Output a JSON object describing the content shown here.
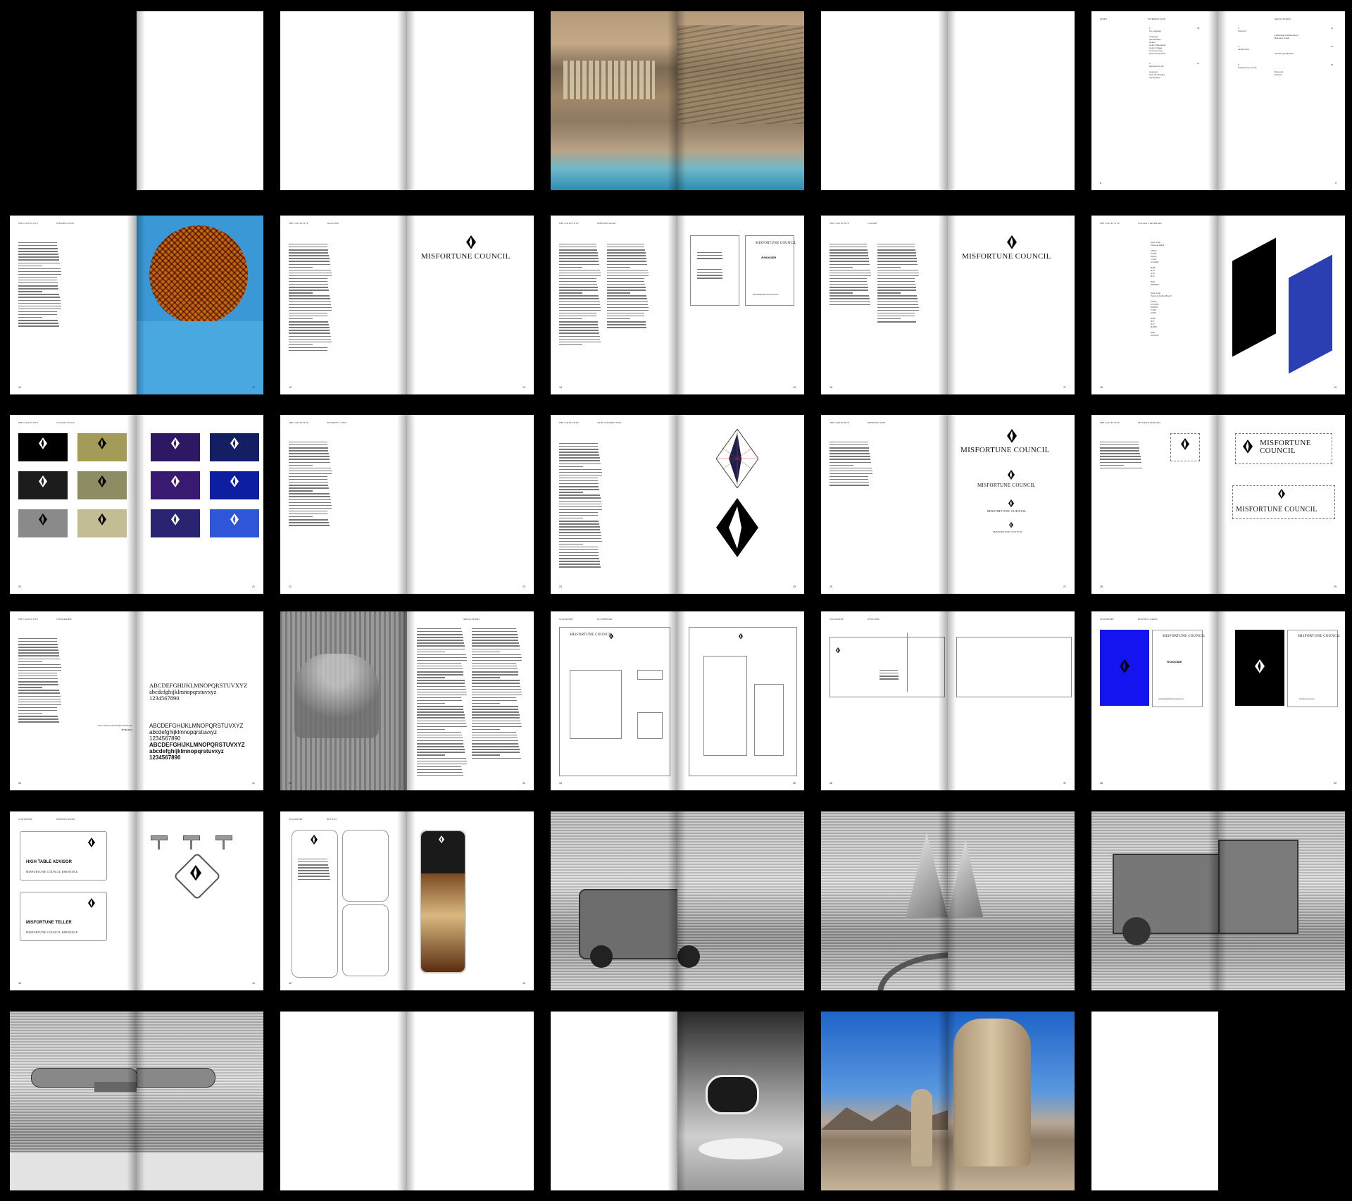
{
  "wordmark": "MISFORTUNE COUNCIL",
  "associate_label": "Associate",
  "role_cards": [
    "HIGH TABLE ADVISOR",
    "MISFORTUNE TELLER"
  ],
  "role_subtitle": "MISFORTUNE COUNCIL EMINENCE",
  "typography": {
    "upper": "ABCDEFGHIJKLMNOPQRSTUVXYZ",
    "lower": "abcdefghijklmnopqrstuvxyz",
    "digits": "1234567890",
    "serif_label": "Neue Haas Unica Display 55 Roman",
    "medium_label": "65 Medium"
  },
  "colors": {
    "background": "#000000",
    "page": "#ffffff",
    "brand_black": "#000000",
    "brand_blue": "#2b3fb2",
    "gold": "#a59b58",
    "olive": "#8e8c62",
    "khaki": "#c2bd94",
    "grey": "#8a8a8a",
    "purple": "#2e1863",
    "navy": "#141e63",
    "deep_purple": "#3a1a70",
    "royal": "#0d1ea0",
    "violet": "#2a2370",
    "bright_blue": "#2f56d6"
  },
  "page_numbers": [
    "8",
    "9",
    "10",
    "11",
    "12",
    "13",
    "14",
    "15",
    "16",
    "17",
    "18",
    "19",
    "20",
    "21",
    "22",
    "23",
    "24",
    "25",
    "26",
    "27",
    "28",
    "29",
    "30",
    "31",
    "32",
    "33",
    "34",
    "35",
    "36",
    "37",
    "38",
    "39",
    "40",
    "41",
    "42",
    "43"
  ],
  "headers": {
    "intro": "THE COLLECTIVE",
    "introduction": "INTRODUCTION",
    "logotype": "LOGOTYPE",
    "identification": "IDENTIFICATION",
    "colour": "COLOUR",
    "colour_standards": "COLOUR STANDARDS",
    "colour_usage": "COLOUR USAGE",
    "incorrect": "INCORRECT USES",
    "grid": "GRID CONSTRUCTION",
    "reproduction": "REPRODUCTION",
    "security": "SECURITY MARGINS",
    "typography": "TYPOGRAPHY",
    "applications": "APPLICATIONS",
    "stationery": "STATIONERY",
    "letterhead": "LETTERHEAD",
    "envelope": "ENVELOPE",
    "business_cards": "BUSINESS CARDS",
    "id": "IDENTIFICATION",
    "devices": "DEVICES",
    "index": "INDEX"
  },
  "index": {
    "col1": [
      "Logotype",
      "Identification",
      "Colour",
      "Colour Standards",
      "Colour Usage",
      "Incorrect Uses",
      "Grid Construction"
    ],
    "col1b": [
      "Logotype",
      "Security Margins",
      "Typography"
    ],
    "col2": [
      "Letterhead and Envelope",
      "Business Cards"
    ],
    "col2b": [
      "Vehicle Identification"
    ],
    "col2c": [
      "Personal",
      "Devices"
    ],
    "sections": [
      "1",
      "The Language",
      "2",
      "Reproduction Kit",
      "3",
      "Stationery",
      "4",
      "Identification",
      "5",
      "Supplementary Goods"
    ],
    "section_pages": [
      "05",
      "07",
      "21",
      "27",
      "33"
    ]
  },
  "swatch_specs": {
    "block1": [
      "Spot Color",
      "Pantone Black",
      "",
      "CMYK",
      "C=0%",
      "M=0%",
      "Y=0%",
      "K=100%",
      "",
      "RGB",
      "R=0",
      "G=0",
      "B=0",
      "",
      "Web",
      "#000000"
    ],
    "block2": [
      "Spot Color",
      "Pantone Reflex Blue C",
      "",
      "CMYK",
      "C=100%",
      "M=80%",
      "Y=0%",
      "K=0%",
      "",
      "RGB",
      "R=7",
      "G=7",
      "B=250",
      "",
      "Web",
      "#0707FF"
    ]
  },
  "card_email": "associate@misfortunecouncil.com",
  "card_url": "www.thecouncil.com"
}
